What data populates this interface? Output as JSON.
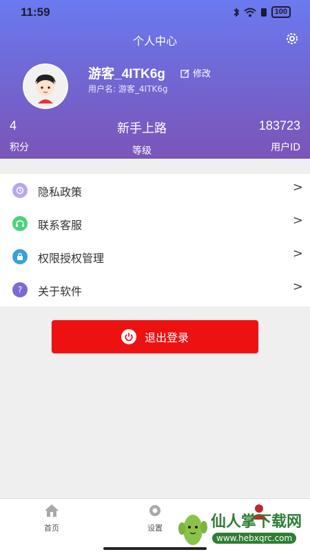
{
  "status_bar": {
    "time": "11:59",
    "battery": "100"
  },
  "header": {
    "title": "个人中心"
  },
  "profile": {
    "username": "游客_4ITK6g",
    "edit_label": "修改",
    "sub_label": "用户名: 游客_4ITK6g"
  },
  "stats": [
    {
      "value": "4",
      "label": "积分"
    },
    {
      "value": "新手上路",
      "label": "等级"
    },
    {
      "value": "183723",
      "label": "用户ID"
    }
  ],
  "menu": [
    {
      "label": "隐私政策",
      "icon": "clock-icon",
      "color": "#b9a6f2"
    },
    {
      "label": "联系客服",
      "icon": "headset-icon",
      "color": "#4cd37a"
    },
    {
      "label": "权限授权管理",
      "icon": "lock-icon",
      "color": "#3aa0d8"
    },
    {
      "label": "关于软件",
      "icon": "question-icon",
      "color": "#7b6ad6"
    }
  ],
  "logout": {
    "label": "退出登录",
    "color": "#ee1111"
  },
  "bottom_nav": [
    {
      "label": "首页",
      "icon": "home-icon"
    },
    {
      "label": "设置",
      "icon": "gear-icon"
    },
    {
      "label": "",
      "icon": "profile-icon"
    }
  ],
  "watermark": {
    "text": "仙人掌下载网",
    "url": "www.hebxqrc.com"
  },
  "colors": {
    "header_top": "#6b7af0",
    "header_bottom": "#7b55b8",
    "accent_red": "#ee1111"
  }
}
